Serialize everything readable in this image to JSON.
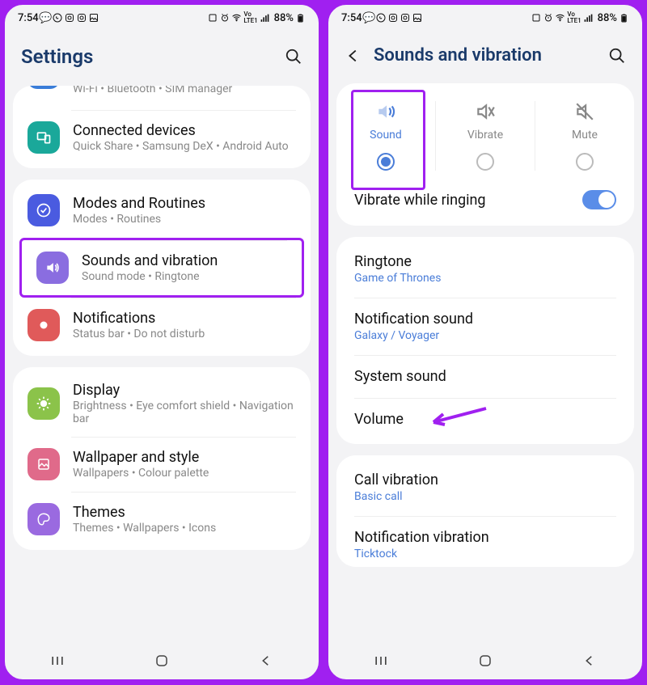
{
  "status": {
    "time": "7:54",
    "battery": "88%",
    "net": "LTE1",
    "vo": "Vo"
  },
  "left": {
    "title": "Settings",
    "group0": {
      "conn_sub": "Wi-Fi  •  Bluetooth  •  SIM manager"
    },
    "group1": {
      "connected": {
        "title": "Connected devices",
        "sub": "Quick Share  •  Samsung DeX  •  Android Auto"
      }
    },
    "group2": {
      "modes": {
        "title": "Modes and Routines",
        "sub": "Modes  •  Routines"
      },
      "sounds": {
        "title": "Sounds and vibration",
        "sub": "Sound mode  •  Ringtone"
      },
      "notif": {
        "title": "Notifications",
        "sub": "Status bar  •  Do not disturb"
      }
    },
    "group3": {
      "display": {
        "title": "Display",
        "sub": "Brightness  •  Eye comfort shield  •  Navigation bar"
      },
      "wallpaper": {
        "title": "Wallpaper and style",
        "sub": "Wallpapers  •  Colour palette"
      },
      "themes": {
        "title": "Themes",
        "sub": "Themes  •  Wallpapers  •  Icons"
      }
    }
  },
  "right": {
    "title": "Sounds and vibration",
    "modes": {
      "sound": "Sound",
      "vibrate": "Vibrate",
      "mute": "Mute"
    },
    "vibrate_ring": "Vibrate while ringing",
    "ringtone": {
      "title": "Ringtone",
      "sub": "Game of Thrones"
    },
    "notif_sound": {
      "title": "Notification sound",
      "sub": "Galaxy / Voyager"
    },
    "system_sound": "System sound",
    "volume": "Volume",
    "call_vib": {
      "title": "Call vibration",
      "sub": "Basic call"
    },
    "notif_vib": {
      "title": "Notification vibration",
      "sub": "Ticktock"
    }
  }
}
